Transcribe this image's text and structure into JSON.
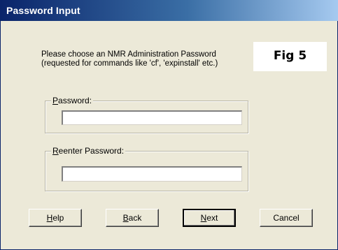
{
  "window": {
    "title": "Password Input"
  },
  "intro": {
    "line1": "Please choose an NMR Administration Password",
    "line2": "(requested for commands like 'cf', 'expinstall' etc.)"
  },
  "figure_label": "Fig 5",
  "password_group": {
    "label_accel": "P",
    "label_rest": "assword:",
    "value": ""
  },
  "reenter_group": {
    "label_accel": "R",
    "label_rest": "eenter Password:",
    "value": ""
  },
  "buttons": {
    "help_accel": "H",
    "help_rest": "elp",
    "back_accel": "B",
    "back_rest": "ack",
    "next_accel": "N",
    "next_rest": "ext",
    "cancel": "Cancel"
  },
  "colors": {
    "title_bar_start": "#0a246a",
    "title_bar_end": "#a6caf0",
    "dialog_background": "#ece9d8"
  }
}
